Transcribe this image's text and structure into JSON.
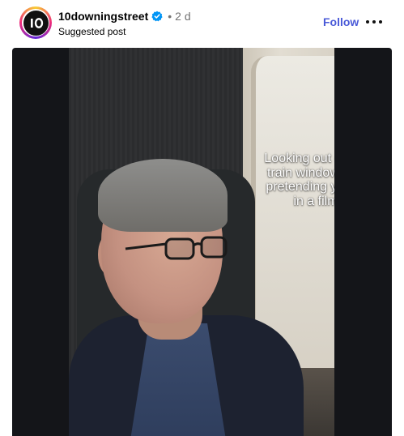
{
  "post": {
    "username": "10downingstreet",
    "separator": "•",
    "time": "2 d",
    "subtitle": "Suggested post",
    "follow_label": "Follow",
    "avatar_text": "I O",
    "verified_icon": "verified-badge-icon",
    "more_icon": "more-options-icon"
  },
  "media": {
    "caption": "Looking out of the\ntrain window and\npretending you're\nin a film"
  },
  "colors": {
    "follow": "#4a5ad8",
    "verified": "#0095f6",
    "media_background": "#141519"
  }
}
